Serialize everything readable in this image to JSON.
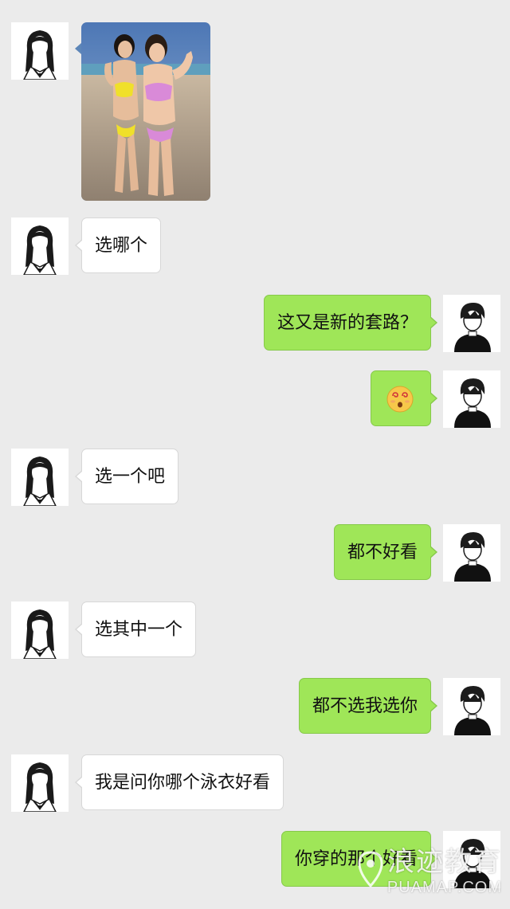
{
  "colors": {
    "background": "#ebebeb",
    "incoming_bubble": "#ffffff",
    "outgoing_bubble": "#9fe658"
  },
  "messages": [
    {
      "side": "left",
      "type": "image",
      "content": "photo-two-women-in-bikinis-at-beach"
    },
    {
      "side": "left",
      "type": "text",
      "text": "选哪个"
    },
    {
      "side": "right",
      "type": "text",
      "text": "这又是新的套路？"
    },
    {
      "side": "right",
      "type": "emoji",
      "content": "dizzy-face-emoji"
    },
    {
      "side": "left",
      "type": "text",
      "text": "选一个吧"
    },
    {
      "side": "right",
      "type": "text",
      "text": "都不好看"
    },
    {
      "side": "left",
      "type": "text",
      "text": "选其中一个"
    },
    {
      "side": "right",
      "type": "text",
      "text": "都不选我选你"
    },
    {
      "side": "left",
      "type": "text",
      "text": "我是问你哪个泳衣好看"
    },
    {
      "side": "right",
      "type": "text",
      "text": "你穿的那个好看"
    }
  ],
  "avatars": {
    "left": "girl-sailor-uniform-avatar",
    "right": "boy-black-shirt-avatar"
  },
  "watermark": {
    "main": "浪迹教育",
    "sub": "PUAMAP.COM"
  }
}
